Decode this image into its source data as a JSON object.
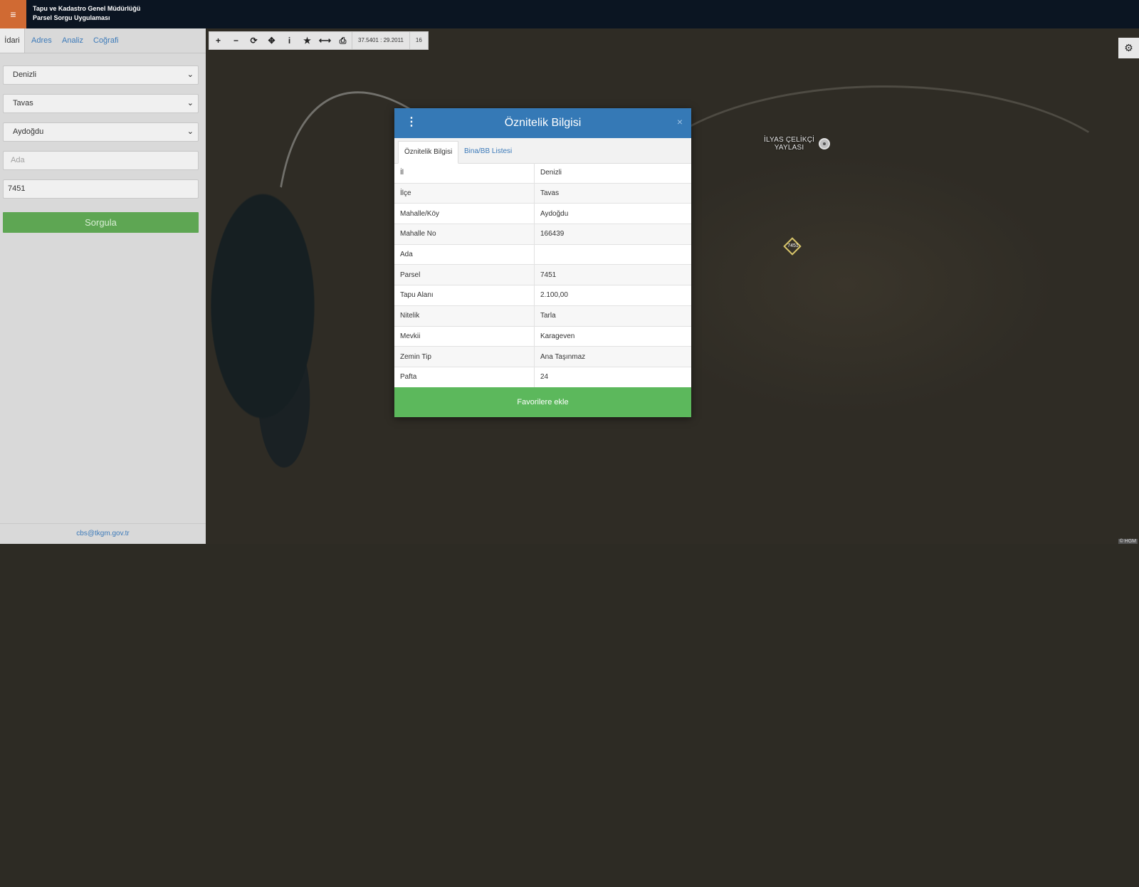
{
  "header": {
    "menu_icon": "≡",
    "org_name": "Tapu ve Kadastro Genel Müdürlüğü",
    "app_name": "Parsel Sorgu Uygulaması"
  },
  "sidebar": {
    "tabs": [
      {
        "label": "İdari"
      },
      {
        "label": "Adres"
      },
      {
        "label": "Analiz"
      },
      {
        "label": "Coğrafi"
      }
    ],
    "province": "Denizli",
    "district": "Tavas",
    "neighborhood": "Aydoğdu",
    "block_placeholder": "Ada",
    "block_value": "",
    "parcel_value": "7451",
    "query_label": "Sorgula",
    "footer_email": "cbs@tkgm.gov.tr"
  },
  "toolbar": {
    "zoom_in": "+",
    "zoom_out": "−",
    "refresh": "⟳",
    "move": "✥",
    "info": "i",
    "favorite": "★",
    "measure": "⟷",
    "print": "⎙",
    "coordinates": "37.5401 : 29.2011",
    "zoom_level": "16"
  },
  "map": {
    "settings_icon": "⚙",
    "place_line1": "İLYAS ÇELİKÇİ",
    "place_line2": "YAYLASI",
    "parcel_label": "7451",
    "attribution": "© HGM"
  },
  "modal": {
    "menu_icon": "⋮",
    "title": "Öznitelik Bilgisi",
    "close_icon": "×",
    "tabs": [
      {
        "label": "Öznitelik Bilgisi"
      },
      {
        "label": "Bina/BB Listesi"
      }
    ],
    "rows": [
      {
        "key": "İl",
        "value": "Denizli"
      },
      {
        "key": "İlçe",
        "value": "Tavas"
      },
      {
        "key": "Mahalle/Köy",
        "value": "Aydoğdu"
      },
      {
        "key": "Mahalle No",
        "value": "166439"
      },
      {
        "key": "Ada",
        "value": ""
      },
      {
        "key": "Parsel",
        "value": "7451"
      },
      {
        "key": "Tapu Alanı",
        "value": "2.100,00"
      },
      {
        "key": "Nitelik",
        "value": "Tarla"
      },
      {
        "key": "Mevkii",
        "value": "Karageven"
      },
      {
        "key": "Zemin Tip",
        "value": "Ana Taşınmaz"
      },
      {
        "key": "Pafta",
        "value": "24"
      }
    ],
    "favorite_label": "Favorilere ekle"
  }
}
